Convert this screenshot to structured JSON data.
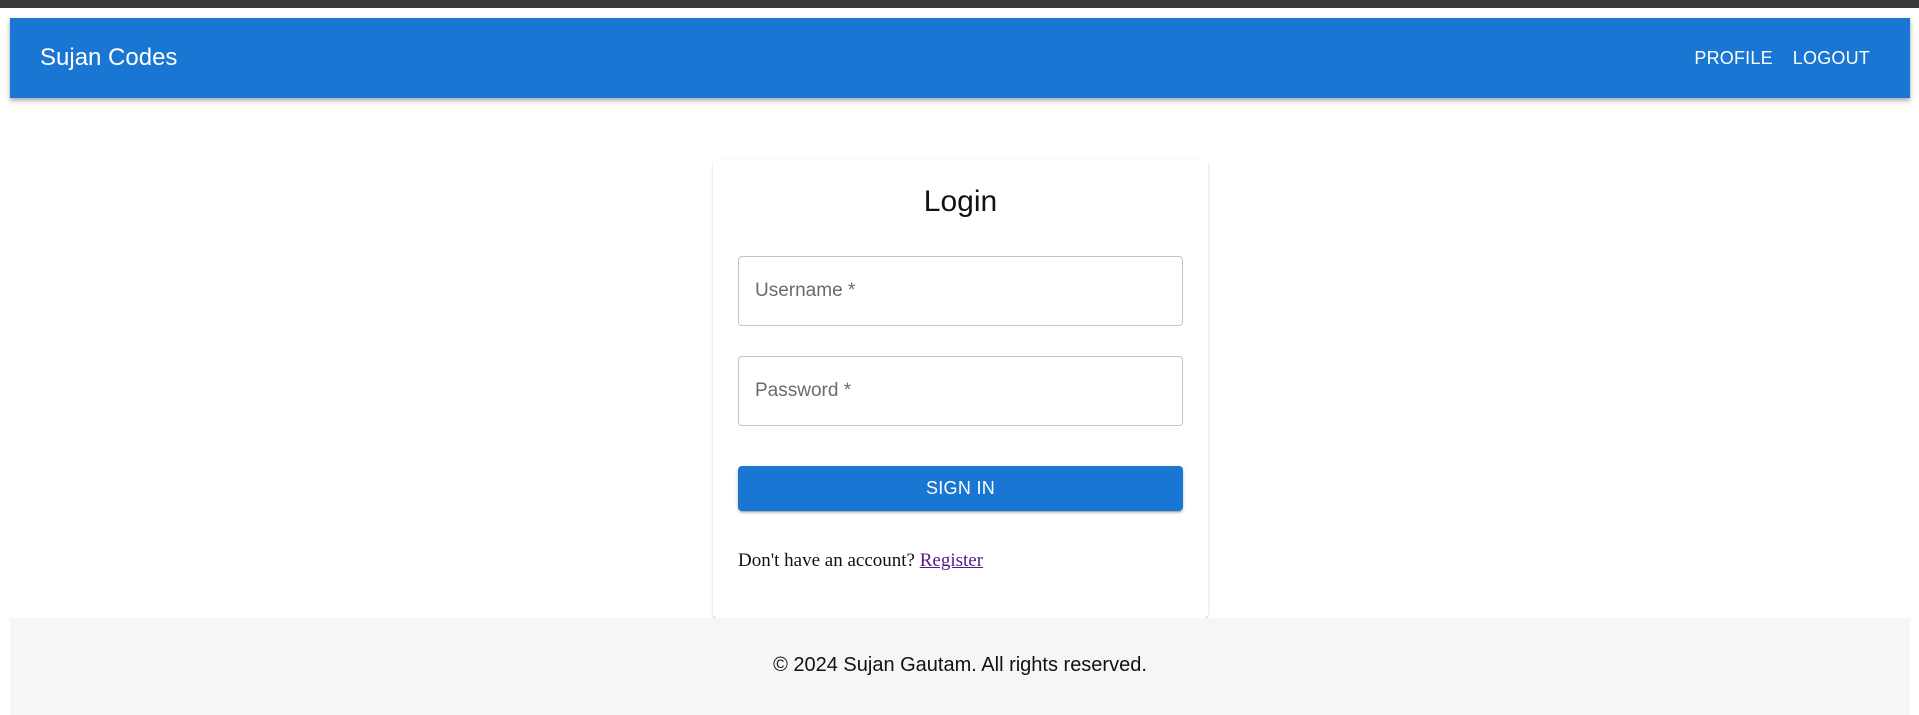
{
  "header": {
    "brand": "Sujan Codes",
    "nav": {
      "profile": "PROFILE",
      "logout": "LOGOUT"
    }
  },
  "login_card": {
    "title": "Login",
    "username_placeholder": "Username *",
    "password_placeholder": "Password *",
    "signin_label": "SIGN IN",
    "register_prompt": "Don't have an account? ",
    "register_link": "Register"
  },
  "footer": {
    "text": "© 2024 Sujan Gautam. All rights reserved."
  },
  "colors": {
    "primary": "#1976d2",
    "footer_bg": "#f6f6f6",
    "visited_link": "#551a8b"
  }
}
